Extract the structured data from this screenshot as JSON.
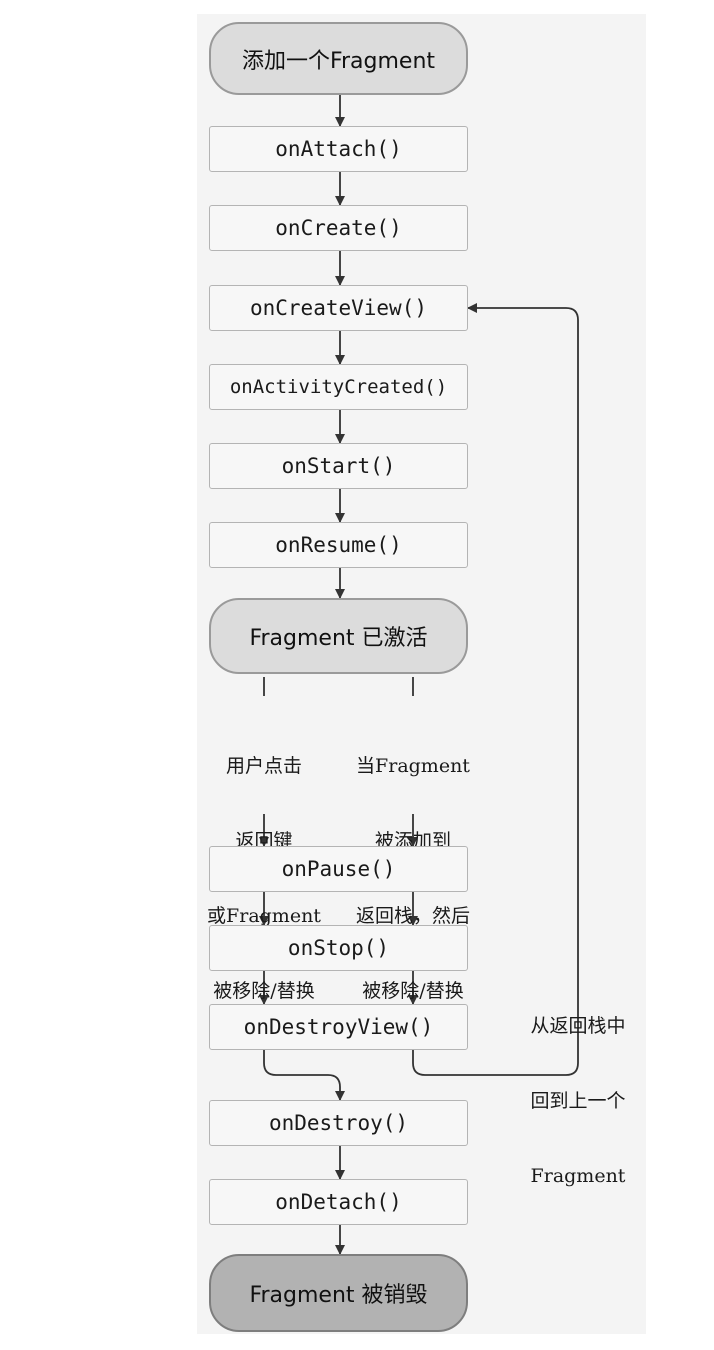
{
  "nodes": {
    "start": "添加一个Fragment",
    "on_attach": "onAttach()",
    "on_create": "onCreate()",
    "on_create_view": "onCreateView()",
    "on_activity_created": "onActivityCreated()",
    "on_start": "onStart()",
    "on_resume": "onResume()",
    "active": "Fragment 已激活",
    "on_pause": "onPause()",
    "on_stop": "onStop()",
    "on_destroy_view": "onDestroyView()",
    "on_destroy": "onDestroy()",
    "on_detach": "onDetach()",
    "end": "Fragment 被销毁"
  },
  "labels": {
    "left_branch": [
      "用户点击",
      "返回键",
      "或Fragment",
      "被移除/替换"
    ],
    "right_branch": [
      "当Fragment",
      "被添加到",
      "返回栈，然后",
      "被移除/替换"
    ],
    "back_loop": [
      "从返回栈中",
      "回到上一个",
      "Fragment"
    ]
  },
  "colors": {
    "panel": "#f4f4f4",
    "box_fill": "#f7f7f7",
    "box_border": "#b4b4b4",
    "pill_light": "#dcdcdc",
    "pill_dark": "#b2b2b2",
    "arrow": "#333333"
  }
}
